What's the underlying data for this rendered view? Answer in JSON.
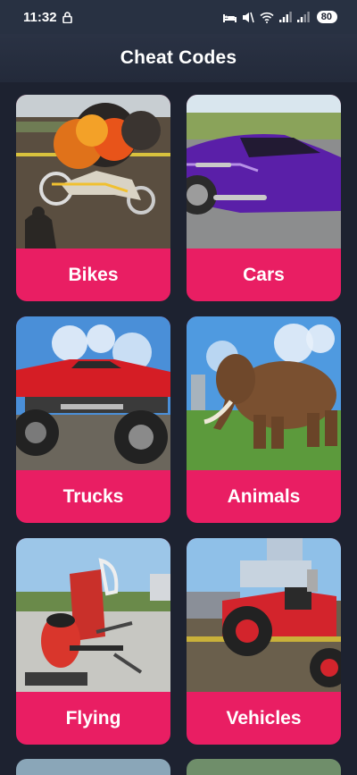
{
  "status": {
    "time": "11:32",
    "battery": "80"
  },
  "header": {
    "title": "Cheat Codes"
  },
  "categories": [
    {
      "label": "Bikes"
    },
    {
      "label": "Cars"
    },
    {
      "label": "Trucks"
    },
    {
      "label": "Animals"
    },
    {
      "label": "Flying"
    },
    {
      "label": "Vehicles"
    }
  ],
  "colors": {
    "accent": "#e91e63",
    "background": "#1d2230",
    "header": "#283142"
  }
}
